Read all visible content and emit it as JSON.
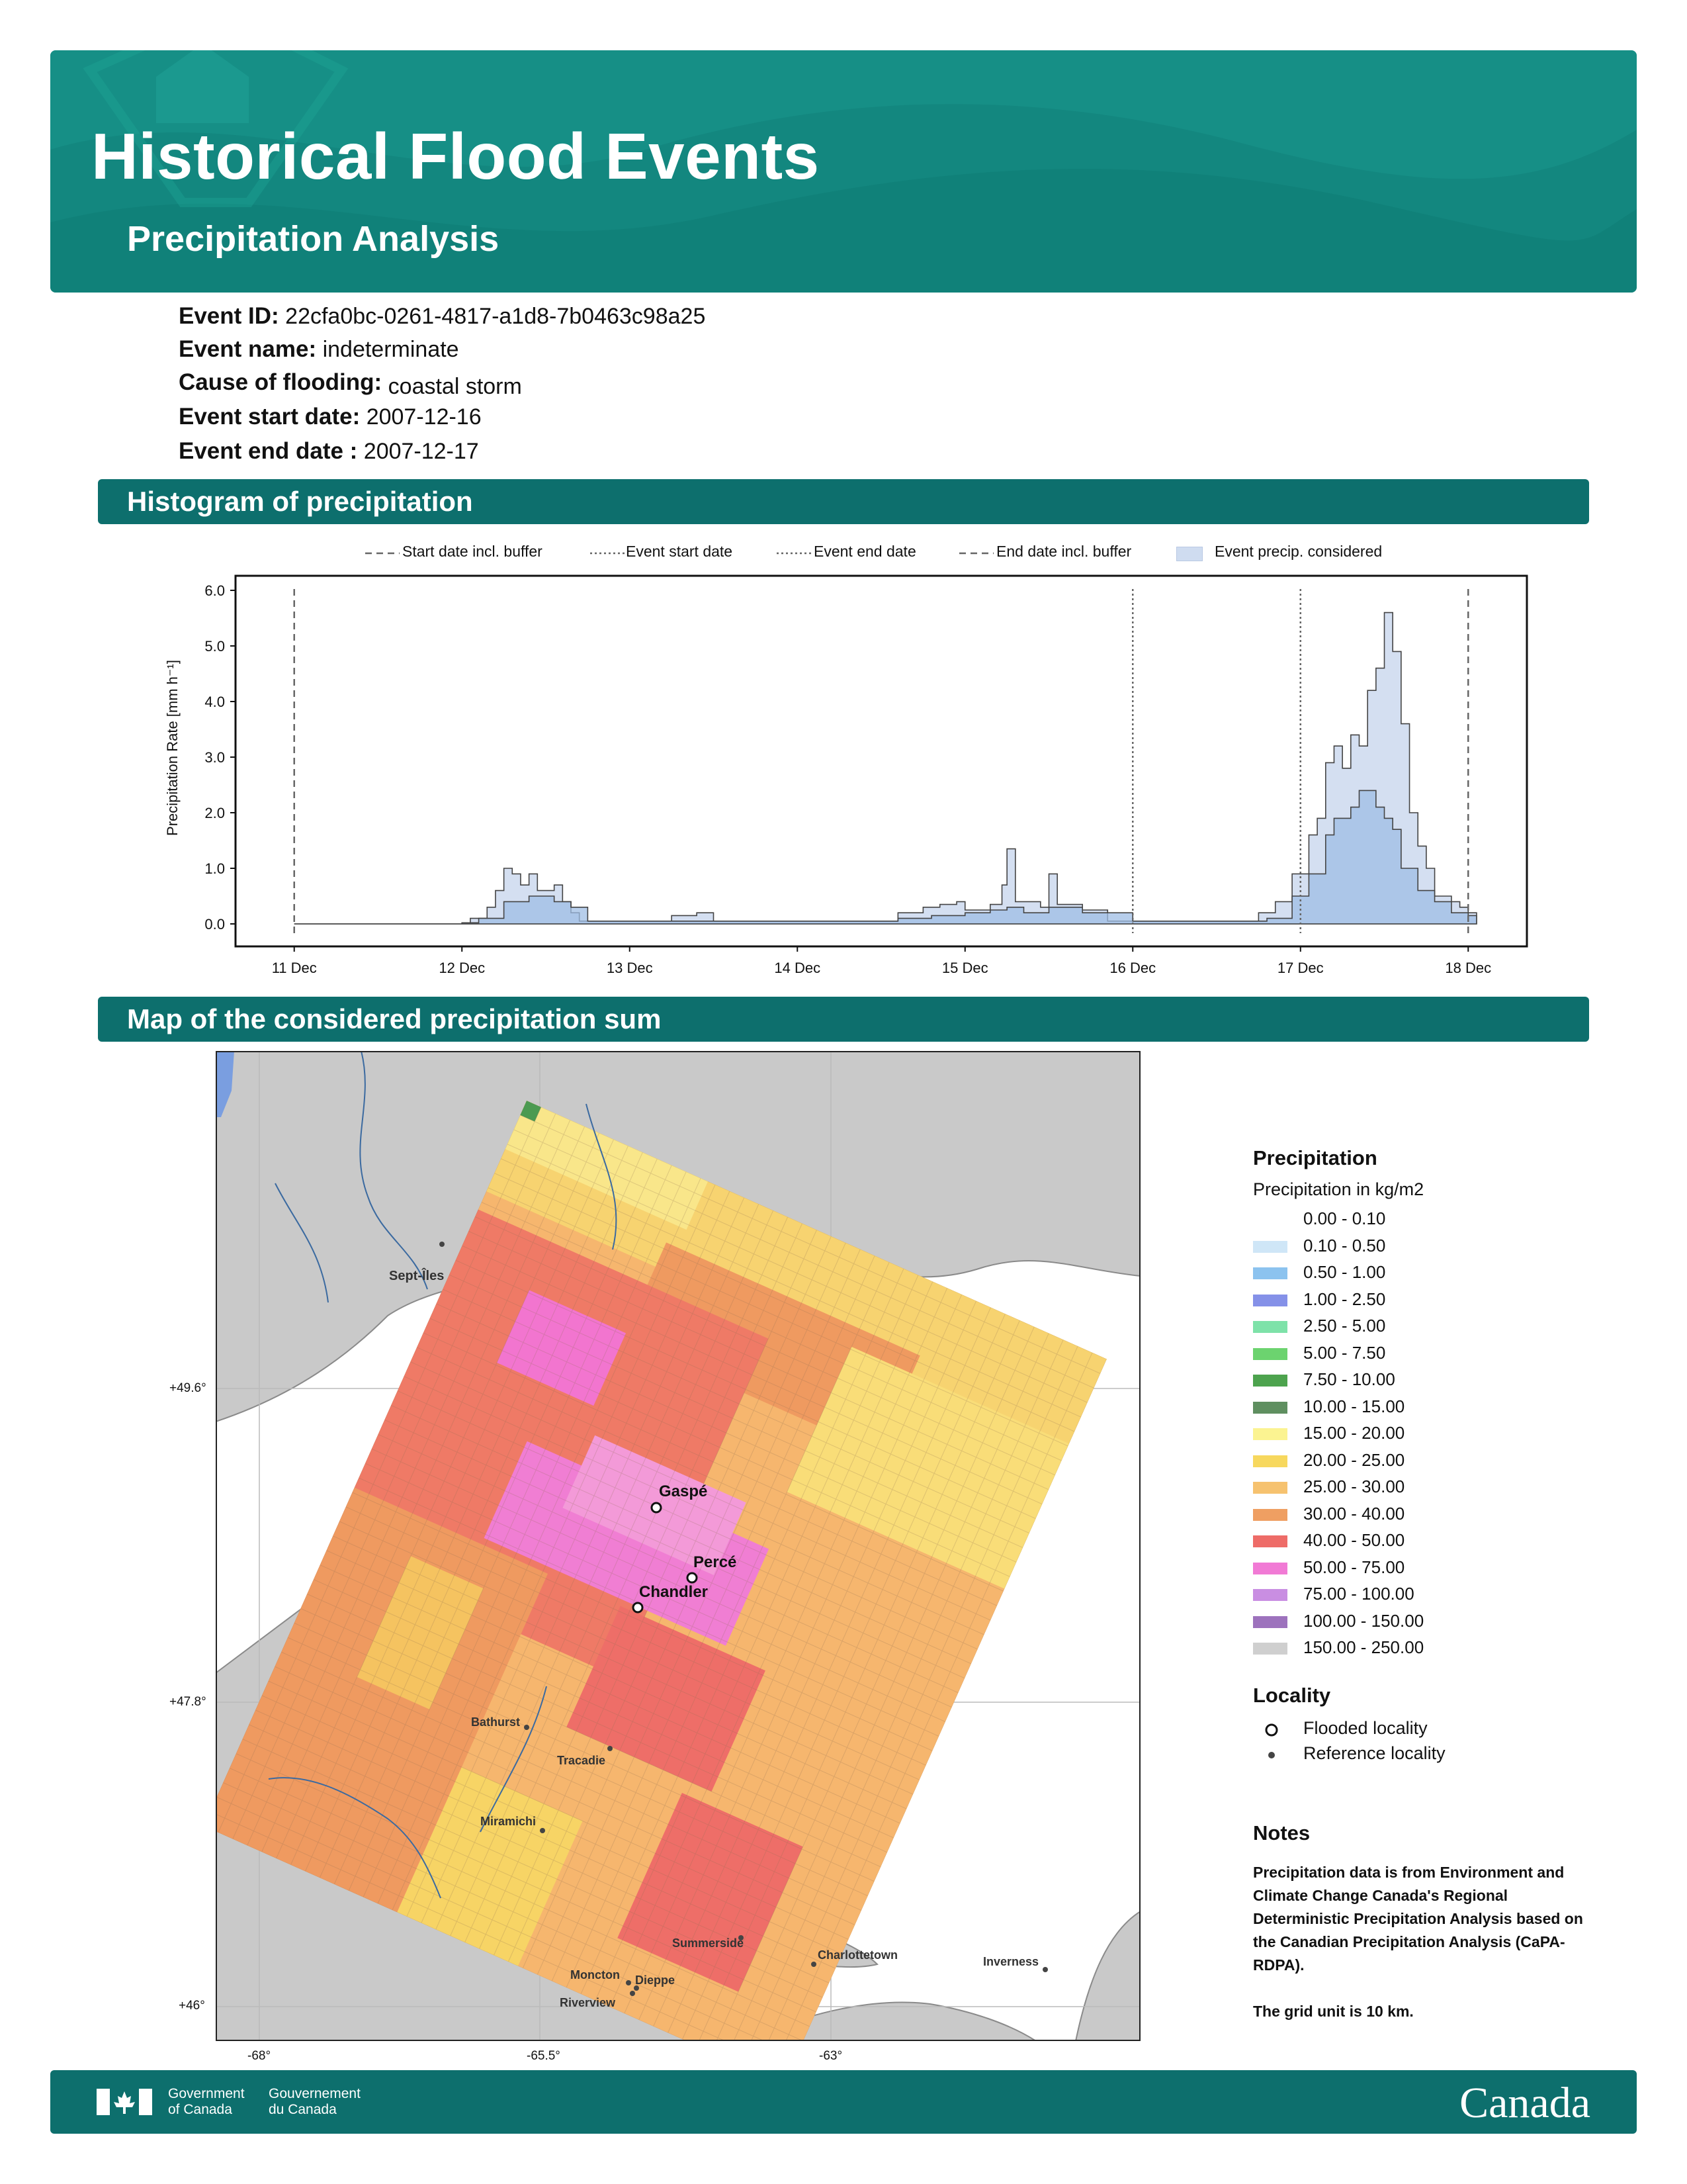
{
  "header": {
    "title": "Historical Flood Events",
    "subtitle": "Precipitation Analysis"
  },
  "event": [
    {
      "key": "Event ID:",
      "value": "22cfa0bc-0261-4817-a1d8-7b0463c98a25"
    },
    {
      "key": "Event name:",
      "value": "indeterminate"
    },
    {
      "key": "Cause of flooding:",
      "value": "coastal storm"
    },
    {
      "key": "Event start date:",
      "value": "2007-12-16"
    },
    {
      "key": "Event end date :",
      "value": "2007-12-17"
    }
  ],
  "sections": {
    "histogram": "Histogram of precipitation",
    "map": "Map of the considered precipitation sum"
  },
  "histogram_legend": [
    "Start date incl. buffer",
    "Event start date",
    "Event end date",
    "End date incl. buffer",
    "Event precip. considered"
  ],
  "chart_data": {
    "type": "area",
    "ylabel": "Precipitation Rate [mm h⁻¹]",
    "xlabel": "",
    "ylim": [
      0,
      6
    ],
    "yticks": [
      "0.0",
      "1.0",
      "2.0",
      "3.0",
      "4.0",
      "5.0",
      "6.0"
    ],
    "x_ticks": [
      "11 Dec",
      "12 Dec",
      "13 Dec",
      "14 Dec",
      "15 Dec",
      "16 Dec",
      "17 Dec",
      "18 Dec"
    ],
    "vlines": [
      {
        "day": 0,
        "style": "dashed"
      },
      {
        "day": 5,
        "style": "dotted"
      },
      {
        "day": 6,
        "style": "dotted"
      },
      {
        "day": 7,
        "style": "dashed"
      }
    ],
    "days_shown": [
      -0.35,
      7.35
    ],
    "series": [
      {
        "values": [
          [
            0,
            0
          ],
          [
            1,
            0.02
          ],
          [
            1.05,
            0.1
          ],
          [
            1.15,
            0.3
          ],
          [
            1.2,
            0.6
          ],
          [
            1.25,
            1.0
          ],
          [
            1.3,
            0.9
          ],
          [
            1.35,
            0.7
          ],
          [
            1.4,
            0.9
          ],
          [
            1.45,
            0.6
          ],
          [
            1.55,
            0.7
          ],
          [
            1.6,
            0.4
          ],
          [
            1.65,
            0.2
          ],
          [
            1.7,
            0.05
          ],
          [
            2.0,
            0.05
          ],
          [
            2.25,
            0.15
          ],
          [
            2.4,
            0.2
          ],
          [
            2.5,
            0.05
          ],
          [
            3.5,
            0.05
          ],
          [
            3.6,
            0.2
          ],
          [
            3.75,
            0.3
          ],
          [
            3.85,
            0.35
          ],
          [
            3.95,
            0.4
          ],
          [
            4.0,
            0.25
          ],
          [
            4.15,
            0.35
          ],
          [
            4.22,
            0.7
          ],
          [
            4.25,
            1.35
          ],
          [
            4.3,
            0.4
          ],
          [
            4.45,
            0.3
          ],
          [
            4.5,
            0.9
          ],
          [
            4.55,
            0.35
          ],
          [
            4.7,
            0.25
          ],
          [
            4.85,
            0.05
          ],
          [
            5.6,
            0.05
          ],
          [
            5.75,
            0.2
          ],
          [
            5.85,
            0.4
          ],
          [
            5.95,
            0.9
          ],
          [
            6.05,
            1.6
          ],
          [
            6.1,
            1.9
          ],
          [
            6.15,
            2.9
          ],
          [
            6.2,
            3.2
          ],
          [
            6.25,
            2.8
          ],
          [
            6.3,
            3.4
          ],
          [
            6.35,
            3.2
          ],
          [
            6.4,
            4.2
          ],
          [
            6.45,
            4.6
          ],
          [
            6.5,
            5.6
          ],
          [
            6.55,
            4.9
          ],
          [
            6.6,
            3.6
          ],
          [
            6.65,
            2.0
          ],
          [
            6.7,
            1.4
          ],
          [
            6.75,
            1.0
          ],
          [
            6.8,
            0.5
          ],
          [
            6.9,
            0.4
          ],
          [
            6.95,
            0.3
          ],
          [
            7.0,
            0.2
          ]
        ]
      },
      {
        "values": [
          [
            0,
            0
          ],
          [
            1,
            0.02
          ],
          [
            1.1,
            0.1
          ],
          [
            1.25,
            0.4
          ],
          [
            1.4,
            0.5
          ],
          [
            1.55,
            0.4
          ],
          [
            1.65,
            0.3
          ],
          [
            1.75,
            0.05
          ],
          [
            2.2,
            0.05
          ],
          [
            3.6,
            0.1
          ],
          [
            3.8,
            0.15
          ],
          [
            4.0,
            0.2
          ],
          [
            4.15,
            0.25
          ],
          [
            4.25,
            0.3
          ],
          [
            4.35,
            0.2
          ],
          [
            4.5,
            0.3
          ],
          [
            4.7,
            0.2
          ],
          [
            5.0,
            0.05
          ],
          [
            5.8,
            0.1
          ],
          [
            5.95,
            0.5
          ],
          [
            6.05,
            0.9
          ],
          [
            6.15,
            1.6
          ],
          [
            6.2,
            1.9
          ],
          [
            6.3,
            2.1
          ],
          [
            6.35,
            2.4
          ],
          [
            6.45,
            2.1
          ],
          [
            6.5,
            1.9
          ],
          [
            6.55,
            1.7
          ],
          [
            6.6,
            1.0
          ],
          [
            6.7,
            0.6
          ],
          [
            6.8,
            0.4
          ],
          [
            6.9,
            0.2
          ],
          [
            7.0,
            0.15
          ]
        ]
      }
    ]
  },
  "map": {
    "x_ticks": [
      "-68°",
      "-65.5°",
      "-63°"
    ],
    "y_ticks": [
      "+49.6°",
      "+47.8°",
      "+46°"
    ],
    "flooded": [
      "Gaspé",
      "Percé",
      "Chandler"
    ],
    "reference": [
      "Sept-Îles",
      "Bathurst",
      "Tracadie",
      "Miramichi",
      "Summerside",
      "Charlottetown",
      "Inverness",
      "Moncton",
      "Dieppe",
      "Riverview"
    ]
  },
  "precip_legend": {
    "title": "Precipitation",
    "subtitle": "Precipitation in kg/m2",
    "classes": [
      {
        "label": "0.00 - 0.10",
        "color": "#ffffff"
      },
      {
        "label": "0.10 - 0.50",
        "color": "#cfe6f7"
      },
      {
        "label": "0.50 - 1.00",
        "color": "#8cc3ef"
      },
      {
        "label": "1.00 - 2.50",
        "color": "#8591e8"
      },
      {
        "label": "2.50 - 5.00",
        "color": "#7ee2a9"
      },
      {
        "label": "5.00 - 7.50",
        "color": "#6cd36f"
      },
      {
        "label": "7.50 - 10.00",
        "color": "#4da34e"
      },
      {
        "label": "10.00 - 15.00",
        "color": "#5f8f60"
      },
      {
        "label": "15.00 - 20.00",
        "color": "#fbf391"
      },
      {
        "label": "20.00 - 25.00",
        "color": "#f7d85e"
      },
      {
        "label": "25.00 - 30.00",
        "color": "#f6c26f"
      },
      {
        "label": "30.00 - 40.00",
        "color": "#ef9f62"
      },
      {
        "label": "40.00 - 50.00",
        "color": "#ee6c68"
      },
      {
        "label": "50.00 - 75.00",
        "color": "#f17ad5"
      },
      {
        "label": "75.00 - 100.00",
        "color": "#c98ee2"
      },
      {
        "label": "100.00 - 150.00",
        "color": "#9d72bd"
      },
      {
        "label": "150.00 - 250.00",
        "color": "#cfcfcf"
      }
    ]
  },
  "locality_legend": {
    "title": "Locality",
    "flooded": "Flooded locality",
    "reference": "Reference locality"
  },
  "notes": {
    "title": "Notes",
    "text1": "Precipitation data is from Environment and Climate Change Canada's Regional Deterministic Precipitation Analysis based on the Canadian Precipitation Analysis (CaPA-RDPA).",
    "text2": "The grid unit is 10 km."
  },
  "footer": {
    "gov_en_1": "Government",
    "gov_en_2": "of Canada",
    "gov_fr_1": "Gouvernement",
    "gov_fr_2": "du Canada",
    "wordmark": "Canada"
  }
}
